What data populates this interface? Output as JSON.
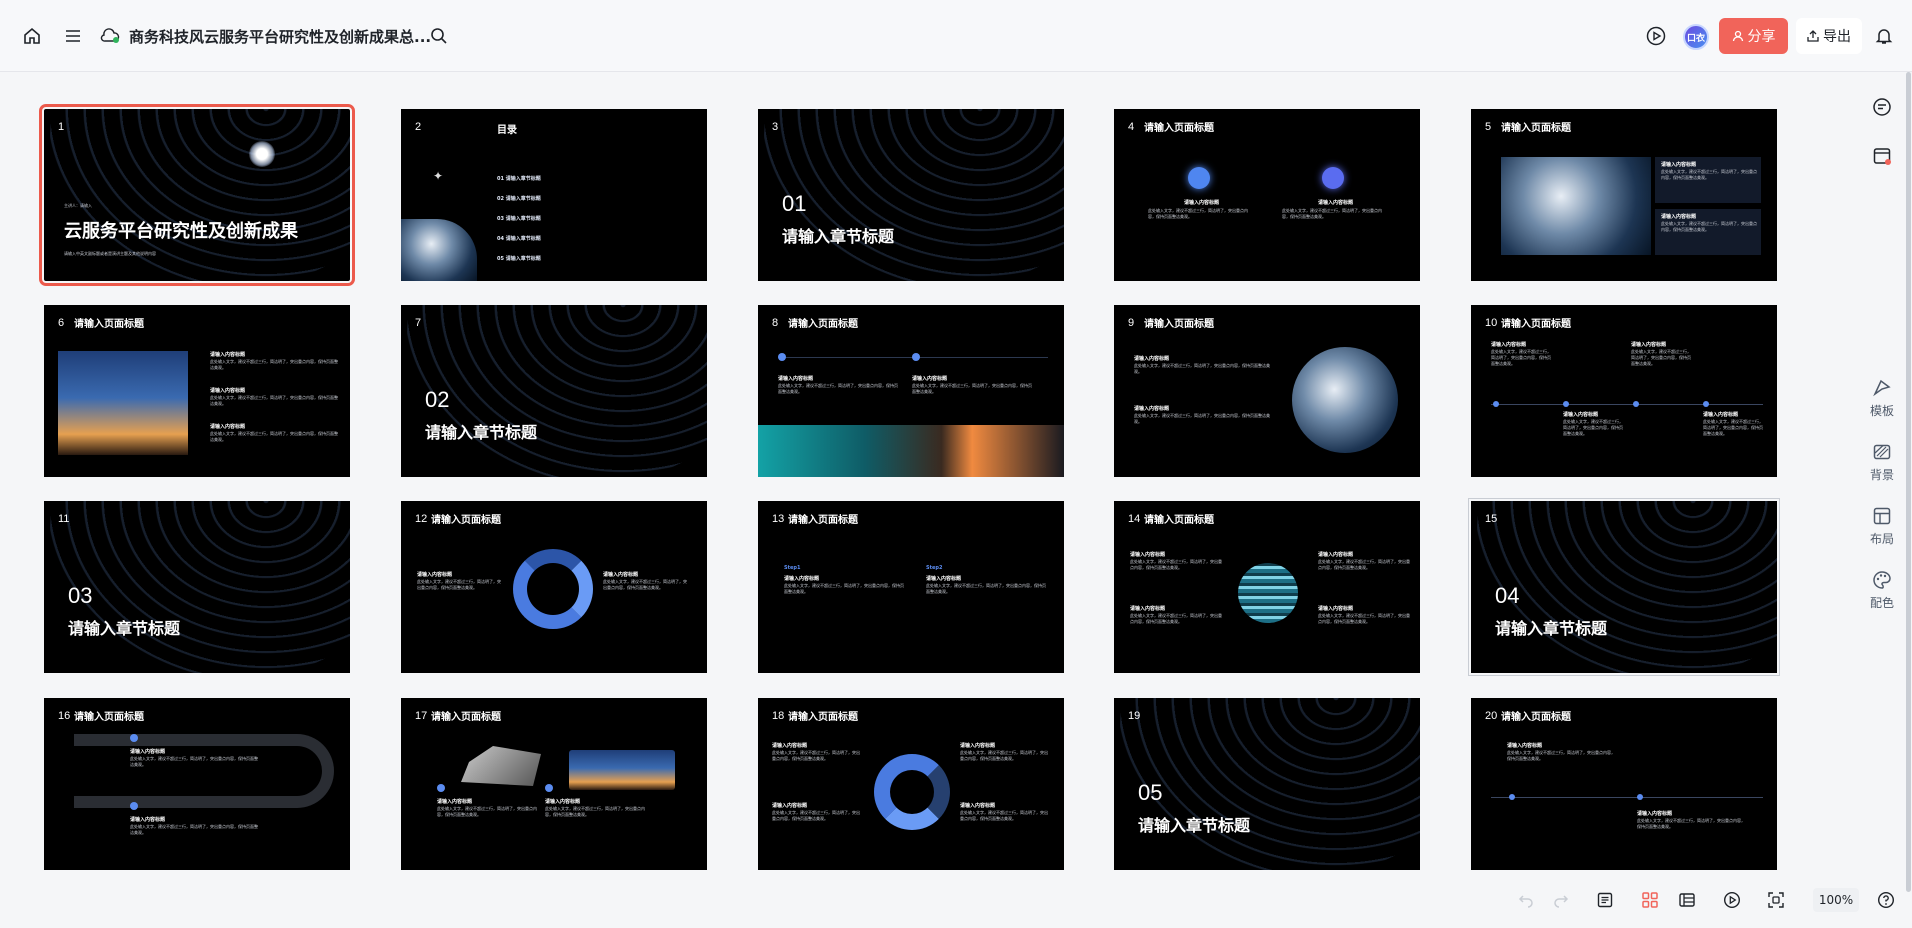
{
  "header": {
    "doc_title": "商务科技风云服务平台研究性及创新成果总...",
    "avatar_text": "口衣",
    "share_label": "分享",
    "export_label": "导出"
  },
  "rail": {
    "template": "模板",
    "background": "背景",
    "layout": "布局",
    "color": "配色"
  },
  "toolbar": {
    "zoom": "100%"
  },
  "slides": {
    "s1": {
      "num": "1",
      "title": "云服务平台研究性及创新成果",
      "sub": "主讲人：请输入",
      "foot": "请输入中英文副标题或者是演讲主题及其他说明内容"
    },
    "s2": {
      "num": "2",
      "title": "目录",
      "items": [
        "01  请输入章节标题",
        "02  请输入章节标题",
        "03  请输入章节标题",
        "04  请输入章节标题",
        "05  请输入章节标题"
      ]
    },
    "s3": {
      "num": "3",
      "chap": "01",
      "title": "请输入章节标题"
    },
    "s4": {
      "num": "4",
      "title": "请输入页面标题"
    },
    "s5": {
      "num": "5",
      "title": "请输入页面标题"
    },
    "s6": {
      "num": "6",
      "title": "请输入页面标题"
    },
    "s7": {
      "num": "7",
      "chap": "02",
      "title": "请输入章节标题"
    },
    "s8": {
      "num": "8",
      "title": "请输入页面标题"
    },
    "s9": {
      "num": "9",
      "title": "请输入页面标题"
    },
    "s10": {
      "num": "10",
      "title": "请输入页面标题"
    },
    "s11": {
      "num": "11",
      "chap": "03",
      "title": "请输入章节标题"
    },
    "s12": {
      "num": "12",
      "title": "请输入页面标题"
    },
    "s13": {
      "num": "13",
      "title": "请输入页面标题",
      "step1": "Step1",
      "step2": "Step2"
    },
    "s14": {
      "num": "14",
      "title": "请输入页面标题"
    },
    "s15": {
      "num": "15",
      "chap": "04",
      "title": "请输入章节标题"
    },
    "s16": {
      "num": "16",
      "title": "请输入页面标题"
    },
    "s17": {
      "num": "17",
      "title": "请输入页面标题"
    },
    "s18": {
      "num": "18",
      "title": "请输入页面标题"
    },
    "s19": {
      "num": "19",
      "chap": "05",
      "title": "请输入章节标题"
    },
    "s20": {
      "num": "20",
      "title": "请输入页面标题"
    },
    "placeholder_heading": "请输入内容标题",
    "placeholder_body": "此处输入文字，建议不超过三行，简洁明了，突出重点内容，保持页面整洁美观。"
  }
}
